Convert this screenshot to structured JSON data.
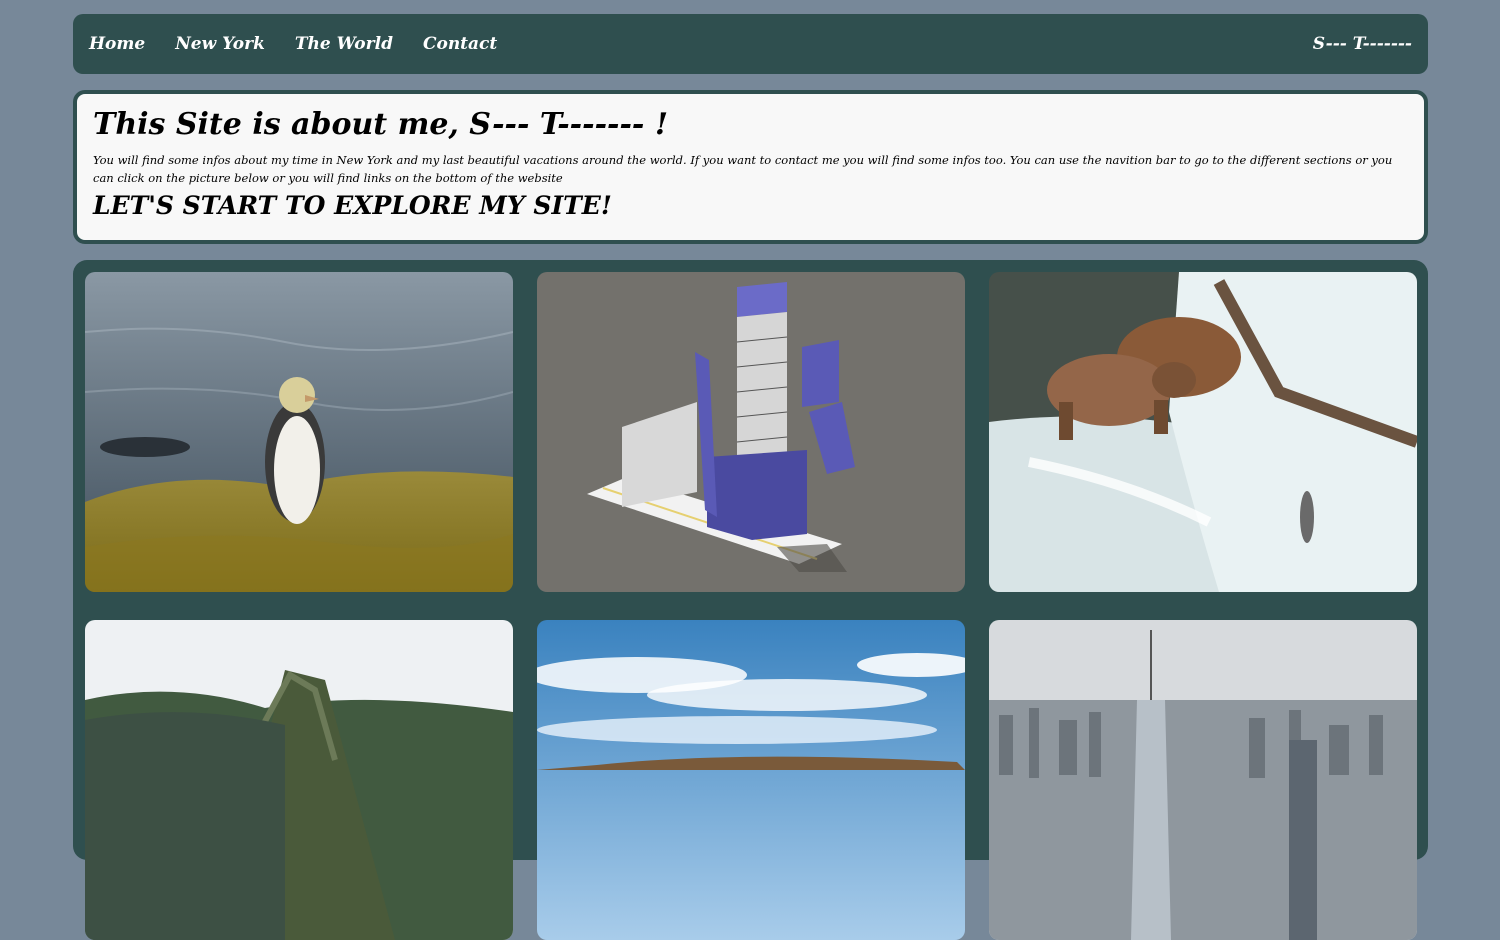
{
  "nav": {
    "links": [
      "Home",
      "New York",
      "The World",
      "Contact"
    ],
    "site_name": "S--- T-------"
  },
  "intro": {
    "title": "This Site is about me, S--- T------- !",
    "description": "You will find some infos about my time in New York and my last beautiful vacations around the world. If you want to contact me you will find some infos too. You can use the navition bar to go to the different sections or you can click on the picture below or you will find links on the bottom of the website",
    "cta": "LET'S START TO EXPLORE MY SITE!"
  },
  "gallery": {
    "pictures": [
      "penguin-photo",
      "tower-diagram-photo",
      "bears-waterfall-photo",
      "mountain-photo",
      "sky-landscape-photo",
      "nyc-skyline-photo"
    ]
  },
  "colors": {
    "background": "#778899",
    "nav_and_gallery": "#2f4f4f",
    "intro_panel": "#f8f8f8"
  }
}
